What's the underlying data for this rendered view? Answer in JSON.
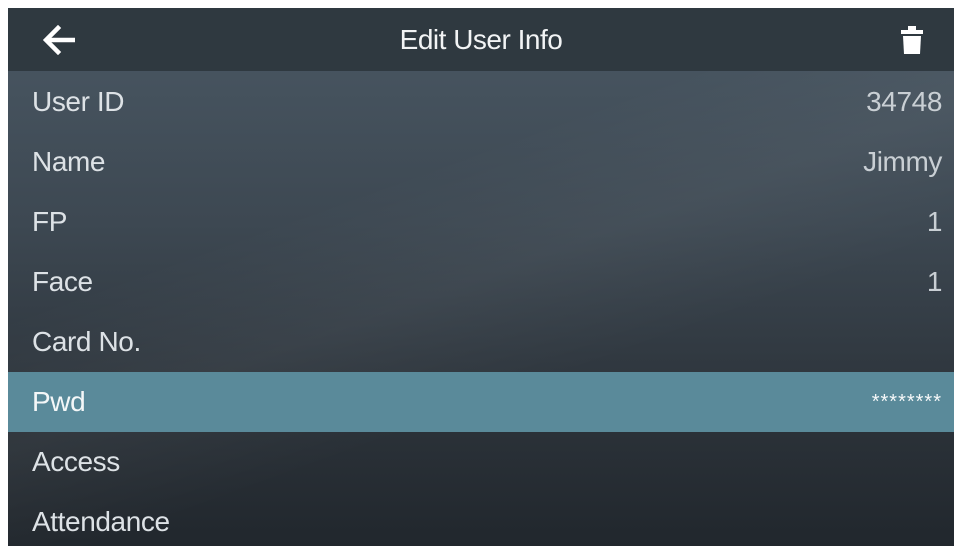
{
  "header": {
    "title": "Edit User Info",
    "back_icon": "arrow-left-icon",
    "delete_icon": "trash-icon"
  },
  "fields": [
    {
      "label": "User ID",
      "value": "34748"
    },
    {
      "label": "Name",
      "value": "Jimmy"
    },
    {
      "label": "FP",
      "value": "1"
    },
    {
      "label": "Face",
      "value": "1"
    },
    {
      "label": "Card No.",
      "value": ""
    },
    {
      "label": "Pwd",
      "value": "********",
      "selected": true
    },
    {
      "label": "Access",
      "value": ""
    },
    {
      "label": "Attendance",
      "value": ""
    }
  ],
  "colors": {
    "header_bg": "#2f3940",
    "selected_row": "#5a8a9a",
    "text": "#dde2e6"
  }
}
